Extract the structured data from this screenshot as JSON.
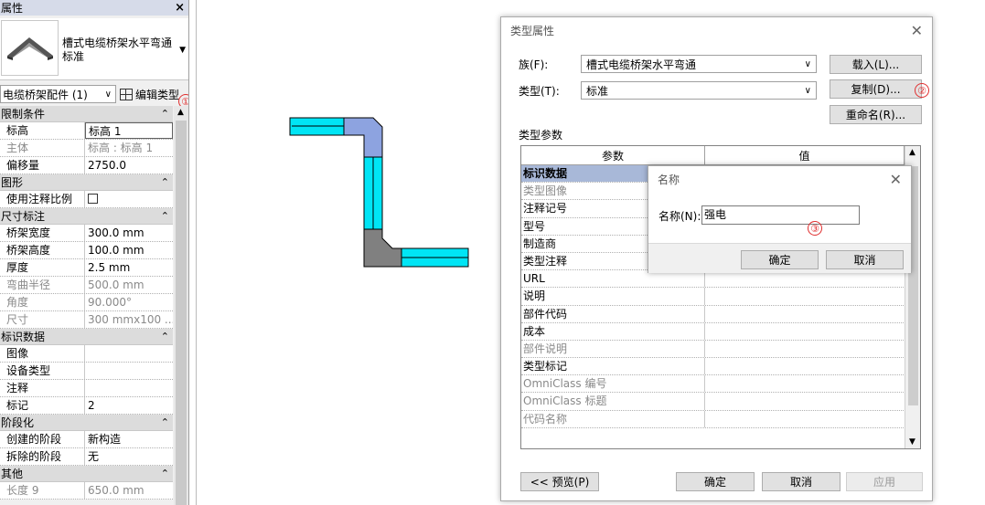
{
  "properties": {
    "title": "属性",
    "close_icon": "×",
    "type_name_line1": "槽式电缆桥架水平弯通",
    "type_name_line2": "标准",
    "instance_filter": "电缆桥架配件 (1)",
    "edit_type_label": "编辑类型",
    "annotation_1": "①",
    "groups": [
      {
        "label": "限制条件",
        "rows": [
          {
            "k": "标高",
            "v": "标高 1",
            "boxed": true
          },
          {
            "k": "主体",
            "v": "标高 : 标高 1",
            "dim": true
          },
          {
            "k": "偏移量",
            "v": "2750.0"
          }
        ]
      },
      {
        "label": "图形",
        "rows": [
          {
            "k": "使用注释比例",
            "checkbox": true
          }
        ]
      },
      {
        "label": "尺寸标注",
        "rows": [
          {
            "k": "桥架宽度",
            "v": "300.0 mm"
          },
          {
            "k": "桥架高度",
            "v": "100.0 mm"
          },
          {
            "k": "厚度",
            "v": "2.5 mm"
          },
          {
            "k": "弯曲半径",
            "v": "500.0 mm",
            "dim": true
          },
          {
            "k": "角度",
            "v": "90.000°",
            "dim": true
          },
          {
            "k": "尺寸",
            "v": "300 mmx100 ...",
            "dim": true
          }
        ]
      },
      {
        "label": "标识数据",
        "rows": [
          {
            "k": "图像",
            "v": ""
          },
          {
            "k": "设备类型",
            "v": ""
          },
          {
            "k": "注释",
            "v": ""
          },
          {
            "k": "标记",
            "v": "2"
          }
        ]
      },
      {
        "label": "阶段化",
        "rows": [
          {
            "k": "创建的阶段",
            "v": "新构造"
          },
          {
            "k": "拆除的阶段",
            "v": "无"
          }
        ]
      },
      {
        "label": "其他",
        "rows": [
          {
            "k": "长度 9",
            "v": "650.0 mm",
            "dim": true
          }
        ]
      }
    ]
  },
  "type_dialog": {
    "title": "类型属性",
    "family_label": "族(F):",
    "family_value": "槽式电缆桥架水平弯通",
    "type_label": "类型(T):",
    "type_value": "标准",
    "load_button": "载入(L)...",
    "duplicate_button": "复制(D)...",
    "rename_button": "重命名(R)...",
    "annotation_2": "②",
    "section_label": "类型参数",
    "col_param": "参数",
    "col_value": "值",
    "rows": [
      {
        "p": "标识数据",
        "group": true
      },
      {
        "p": "类型图像",
        "dim": true
      },
      {
        "p": "注释记号"
      },
      {
        "p": "型号"
      },
      {
        "p": "制造商"
      },
      {
        "p": "类型注释"
      },
      {
        "p": "URL"
      },
      {
        "p": "说明"
      },
      {
        "p": "部件代码"
      },
      {
        "p": "成本"
      },
      {
        "p": "部件说明",
        "dim": true
      },
      {
        "p": "类型标记"
      },
      {
        "p": "OmniClass 编号",
        "dim": true
      },
      {
        "p": "OmniClass 标题",
        "dim": true
      },
      {
        "p": "代码名称",
        "dim": true
      }
    ],
    "preview_button": "<< 预览(P)",
    "ok_button": "确定",
    "cancel_button": "取消",
    "apply_button": "应用"
  },
  "name_dialog": {
    "title": "名称",
    "name_label": "名称(N):",
    "name_value": "强电",
    "annotation_3": "③",
    "ok_button": "确定",
    "cancel_button": "取消"
  },
  "colors": {
    "tray_fill": "#00e5f5",
    "elbow_fill": "#8da3e0",
    "fitting_gray": "#808080",
    "group_highlight": "#a8b8d8",
    "annotation_red": "#e03030"
  }
}
